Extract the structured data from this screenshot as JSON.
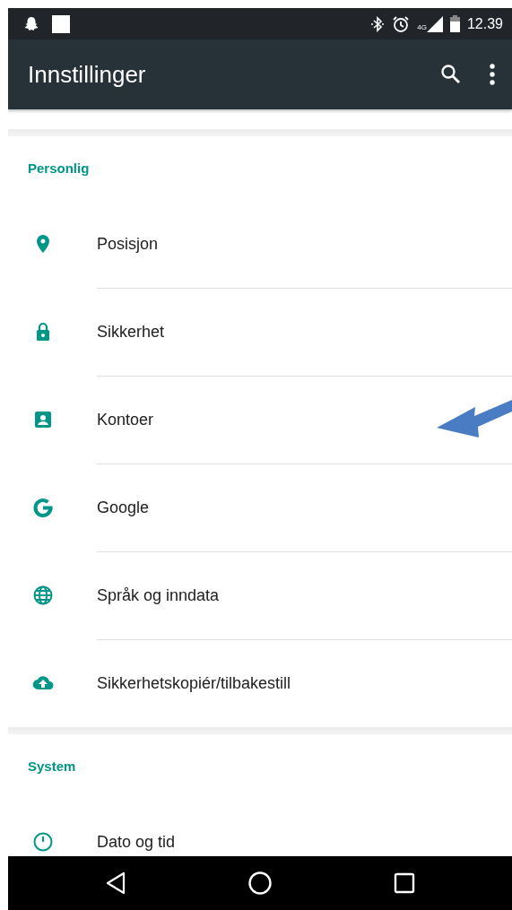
{
  "status_bar": {
    "network": "4G",
    "time": "12.39"
  },
  "app_bar": {
    "title": "Innstillinger"
  },
  "sections": [
    {
      "title": "Personlig",
      "items": [
        {
          "label": "Posisjon",
          "kind": "location"
        },
        {
          "label": "Sikkerhet",
          "kind": "lock"
        },
        {
          "label": "Kontoer",
          "kind": "account"
        },
        {
          "label": "Google",
          "kind": "google"
        },
        {
          "label": "Språk og inndata",
          "kind": "globe"
        },
        {
          "label": "Sikkerhetskopiér/tilbakestill",
          "kind": "cloud"
        }
      ]
    },
    {
      "title": "System",
      "items": [
        {
          "label": "Dato og tid",
          "kind": "clock"
        }
      ]
    }
  ]
}
